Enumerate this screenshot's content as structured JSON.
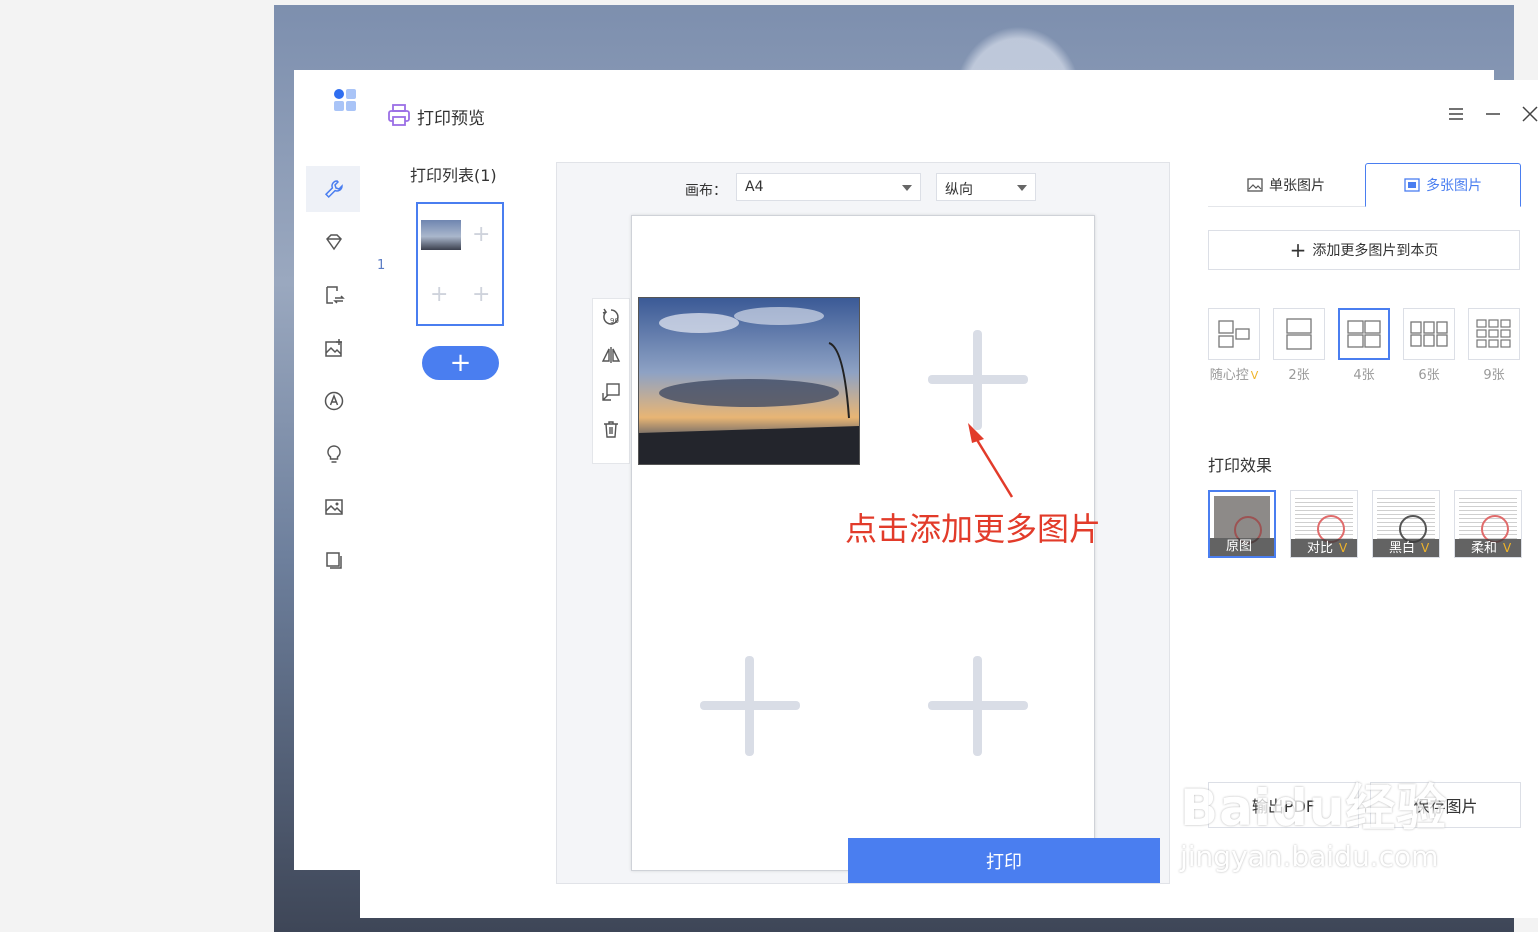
{
  "dialog": {
    "title": "打印预览"
  },
  "print_list": {
    "title": "打印列表(1)",
    "page_index": "1",
    "add_page_label": "+"
  },
  "canvas": {
    "label": "画布：",
    "paper_size": "A4",
    "orientation": "纵向"
  },
  "annotation": {
    "text": "点击添加更多图片"
  },
  "tabs": [
    {
      "label": "单张图片"
    },
    {
      "label": "多张图片"
    }
  ],
  "add_more_label": "添加更多图片到本页",
  "layouts": [
    {
      "label": "随心控",
      "vip": "V"
    },
    {
      "label": "2张"
    },
    {
      "label": "4张"
    },
    {
      "label": "6张"
    },
    {
      "label": "9张"
    }
  ],
  "effects": {
    "title": "打印效果",
    "items": [
      {
        "label": "原图"
      },
      {
        "label": "对比",
        "vip": "V"
      },
      {
        "label": "黑白",
        "vip": "V"
      },
      {
        "label": "柔和",
        "vip": "V"
      }
    ]
  },
  "buttons": {
    "export_pdf": "输出PDF",
    "save_image": "保存图片",
    "print": "打印"
  },
  "watermark": {
    "brand": "Baidu经验",
    "url": "jingyan.baidu.com"
  },
  "colors": {
    "accent": "#4a7ef0",
    "annotation": "#e23b2a"
  }
}
